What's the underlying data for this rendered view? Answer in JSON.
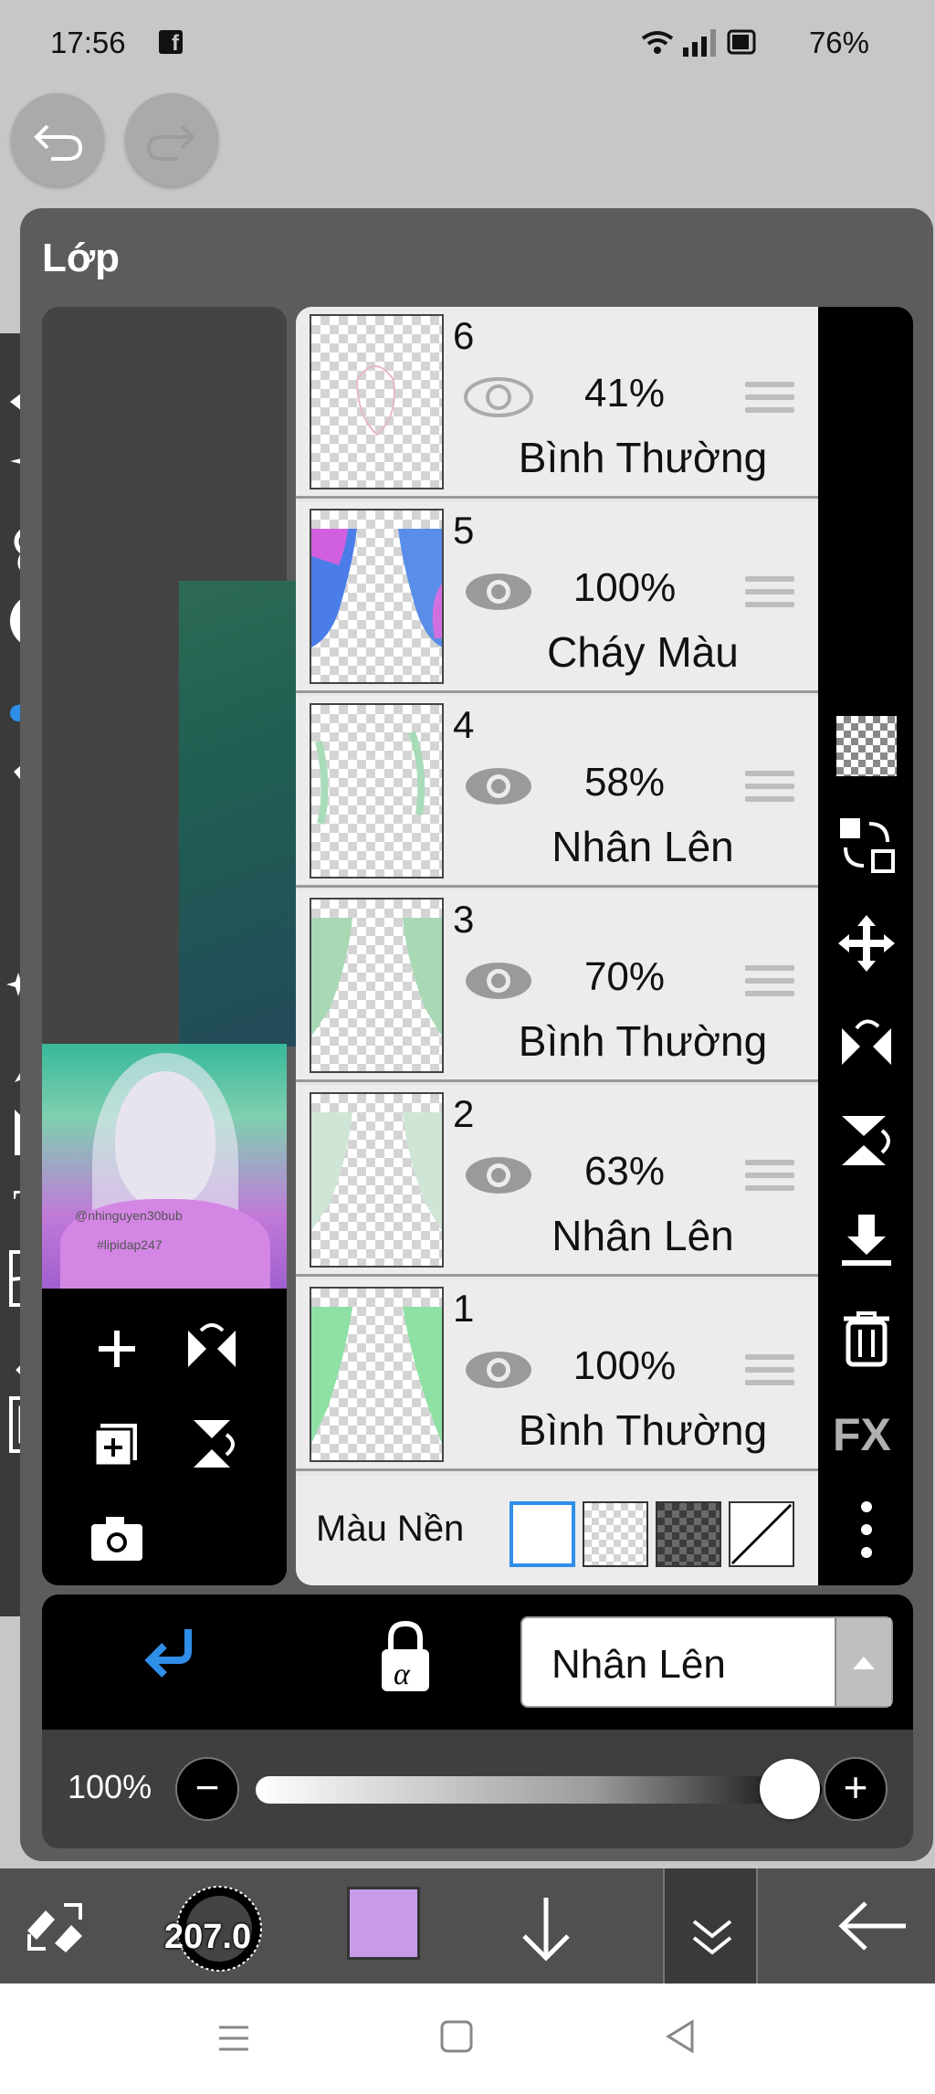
{
  "status_bar": {
    "time": "17:56",
    "battery": "76%",
    "app_icon": "facebook-icon"
  },
  "panel": {
    "title": "Lớp"
  },
  "layers": [
    {
      "number": "6",
      "opacity": "41%",
      "blend": "Bình Thường",
      "eye": "visible-faded"
    },
    {
      "number": "5",
      "opacity": "100%",
      "blend": "Cháy Màu",
      "eye": "visible"
    },
    {
      "number": "4",
      "opacity": "58%",
      "blend": "Nhân Lên",
      "eye": "visible"
    },
    {
      "number": "3",
      "opacity": "70%",
      "blend": "Bình Thường",
      "eye": "visible"
    },
    {
      "number": "2",
      "opacity": "63%",
      "blend": "Nhân Lên",
      "eye": "visible"
    },
    {
      "number": "1",
      "opacity": "100%",
      "blend": "Bình Thường",
      "eye": "visible"
    }
  ],
  "background": {
    "label": "Màu Nền",
    "options": [
      "white",
      "transparent",
      "dark-checker",
      "none"
    ],
    "selected": "white"
  },
  "thumbnail": {
    "watermark_line1": "@nhinguyen30bub",
    "watermark_line2": "#lipidap247"
  },
  "controls": {
    "blend_mode": "Nhân Lên",
    "opacity_label": "100%",
    "opacity_value": 1.0
  },
  "bottom_bar": {
    "brush_size": "207.0",
    "color": "#c79be8"
  },
  "colors": {
    "accent": "#2f8ee8",
    "panel_bg": "#5c5c5c",
    "list_bg": "#ececec"
  }
}
